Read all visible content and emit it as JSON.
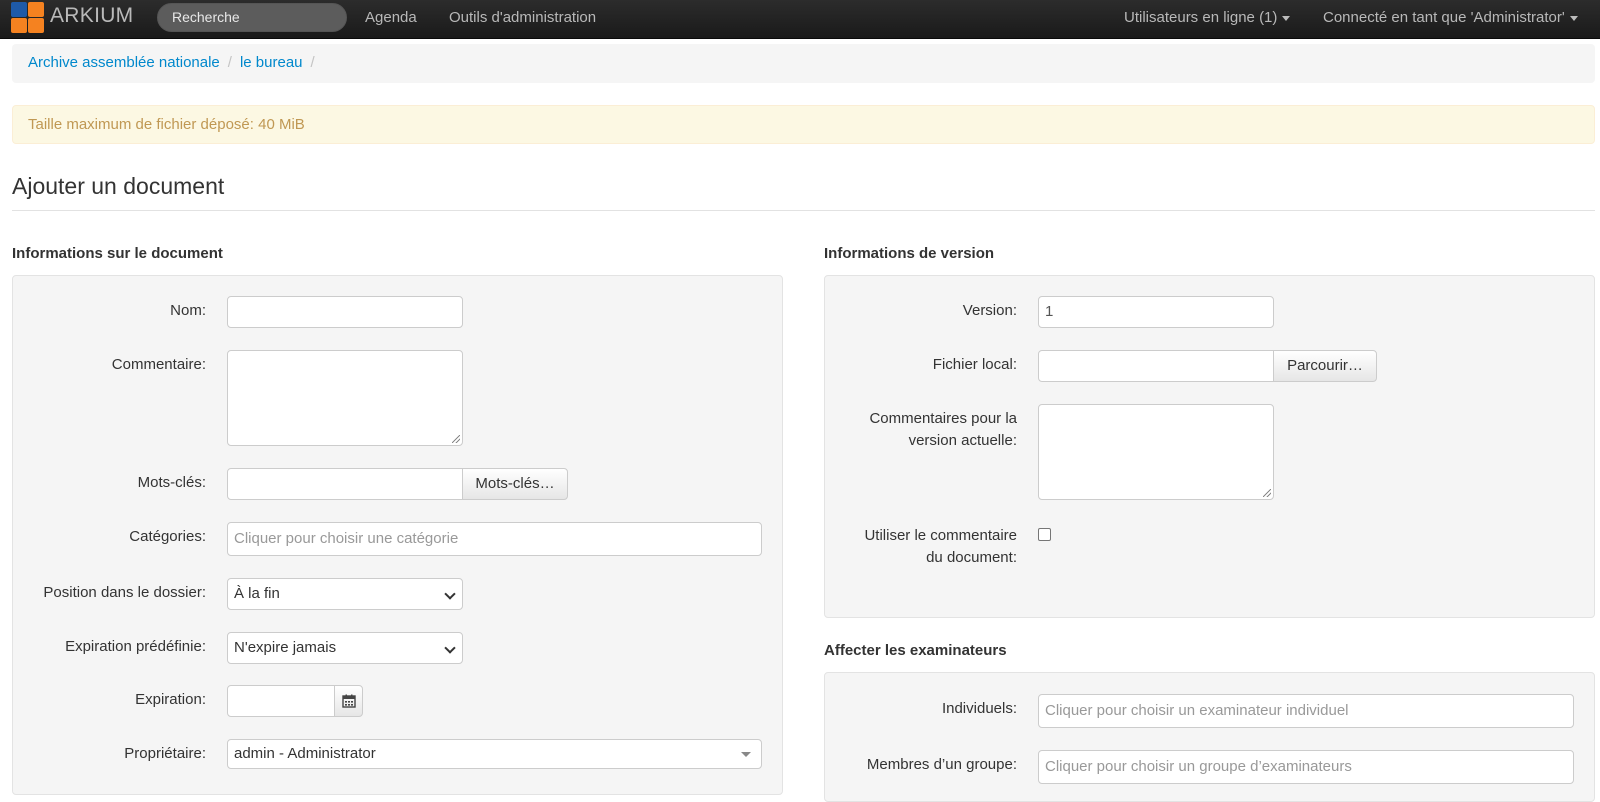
{
  "navbar": {
    "brand": "ARKIUM",
    "search_placeholder": "Recherche",
    "links": {
      "agenda": "Agenda",
      "admin_tools": "Outils d'administration"
    },
    "online_users": "Utilisateurs en ligne (1)",
    "logged_in_as": "Connecté en tant que 'Administrator'",
    "logo_colors": [
      "#f58220",
      "#1e5aa8"
    ]
  },
  "breadcrumb": {
    "items": [
      "Archive assemblée nationale",
      "le bureau"
    ],
    "separator": "/"
  },
  "alert": {
    "text": "Taille maximum de fichier déposé: 40 MiB"
  },
  "page": {
    "title": "Ajouter un document"
  },
  "document_info": {
    "title": "Informations sur le document",
    "name_label": "Nom:",
    "name_value": "",
    "comment_label": "Commentaire:",
    "keywords_label": "Mots-clés:",
    "keywords_button": "Mots-clés…",
    "categories_label": "Catégories:",
    "categories_placeholder": "Cliquer pour choisir une catégorie",
    "position_label": "Position dans le dossier:",
    "position_value": "À la fin",
    "predef_expiration_label": "Expiration prédéfinie:",
    "predef_expiration_value": "N'expire jamais",
    "expiration_label": "Expiration:",
    "expiration_value": "",
    "owner_label": "Propriétaire:",
    "owner_value": "admin - Administrator",
    "calendar_icon": "calendar-icon"
  },
  "version_info": {
    "title": "Informations de version",
    "version_label": "Version:",
    "version_value": "1",
    "local_file_label": "Fichier local:",
    "local_file_value": "",
    "browse_button": "Parcourir…",
    "version_comment_label_1": "Commentaires pour la",
    "version_comment_label_2": "version actuelle:",
    "use_doc_comment_label_1": "Utiliser le commentaire",
    "use_doc_comment_label_2": "du document:",
    "use_doc_comment_checked": false
  },
  "reviewers": {
    "title": "Affecter les examinateurs",
    "individuals_label": "Individuels:",
    "individuals_placeholder": "Cliquer pour choisir un examinateur individuel",
    "group_label": "Membres d’un groupe:",
    "group_placeholder": "Cliquer pour choisir un groupe d’examinateurs"
  }
}
